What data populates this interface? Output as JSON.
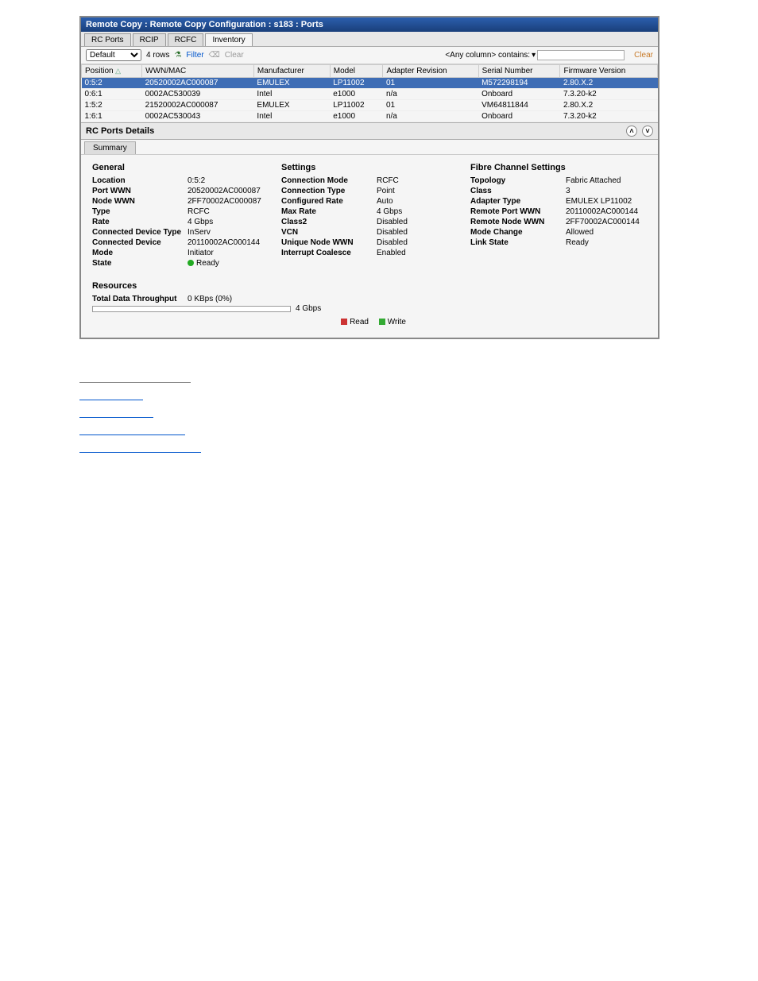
{
  "title": "Remote Copy : Remote Copy Configuration : s183 : Ports",
  "tabs": [
    "RC Ports",
    "RCIP",
    "RCFC",
    "Inventory"
  ],
  "activeTab": 3,
  "toolbar": {
    "default": "Default",
    "rowcount": "4 rows",
    "filter": "Filter",
    "clear": "Clear",
    "searchLabel": "<Any column> contains:",
    "searchClear": "Clear"
  },
  "columns": [
    "Position",
    "WWN/MAC",
    "Manufacturer",
    "Model",
    "Adapter Revision",
    "Serial Number",
    "Firmware Version"
  ],
  "rows": [
    {
      "sel": true,
      "c": [
        "0:5:2",
        "20520002AC000087",
        "EMULEX",
        "LP11002",
        "01",
        "M572298194",
        "2.80.X.2"
      ]
    },
    {
      "sel": false,
      "c": [
        "0:6:1",
        "0002AC530039",
        "Intel",
        "e1000",
        "n/a",
        "Onboard",
        "7.3.20-k2"
      ]
    },
    {
      "sel": false,
      "c": [
        "1:5:2",
        "21520002AC000087",
        "EMULEX",
        "LP11002",
        "01",
        "VM64811844",
        "2.80.X.2"
      ]
    },
    {
      "sel": false,
      "c": [
        "1:6:1",
        "0002AC530043",
        "Intel",
        "e1000",
        "n/a",
        "Onboard",
        "7.3.20-k2"
      ]
    }
  ],
  "detailsHdr": "RC Ports Details",
  "subtab": "Summary",
  "general": {
    "title": "General",
    "items": [
      {
        "k": "Location",
        "v": "0:5:2"
      },
      {
        "k": "Port WWN",
        "v": "20520002AC000087"
      },
      {
        "k": "Node WWN",
        "v": "2FF70002AC000087"
      },
      {
        "k": "Type",
        "v": "RCFC"
      },
      {
        "k": "Rate",
        "v": "4 Gbps"
      },
      {
        "k": "Connected Device Type",
        "v": "InServ"
      },
      {
        "k": "Connected Device",
        "v": "20110002AC000144"
      },
      {
        "k": "Mode",
        "v": "Initiator"
      },
      {
        "k": "State",
        "v": "Ready",
        "dot": true
      }
    ]
  },
  "settings": {
    "title": "Settings",
    "items": [
      {
        "k": "Connection Mode",
        "v": "RCFC"
      },
      {
        "k": "Connection Type",
        "v": "Point"
      },
      {
        "k": "Configured Rate",
        "v": "Auto"
      },
      {
        "k": "Max Rate",
        "v": "4 Gbps"
      },
      {
        "k": "Class2",
        "v": "Disabled"
      },
      {
        "k": "VCN",
        "v": "Disabled"
      },
      {
        "k": "Unique Node WWN",
        "v": "Disabled"
      },
      {
        "k": "Interrupt Coalesce",
        "v": "Enabled"
      }
    ]
  },
  "fc": {
    "title": "Fibre Channel Settings",
    "items": [
      {
        "k": "Topology",
        "v": "Fabric Attached"
      },
      {
        "k": "Class",
        "v": "3"
      },
      {
        "k": "Adapter Type",
        "v": "EMULEX LP11002"
      },
      {
        "k": "Remote Port WWN",
        "v": "20110002AC000144"
      },
      {
        "k": "Remote Node WWN",
        "v": "2FF70002AC000144"
      },
      {
        "k": "Mode Change",
        "v": "Allowed"
      },
      {
        "k": "Link State",
        "v": "Ready"
      }
    ]
  },
  "resources": {
    "title": "Resources",
    "throughputLabel": "Total Data Throughput",
    "throughputValue": "0 KBps (0%)",
    "max": "4 Gbps",
    "read": "Read",
    "write": "Write"
  }
}
